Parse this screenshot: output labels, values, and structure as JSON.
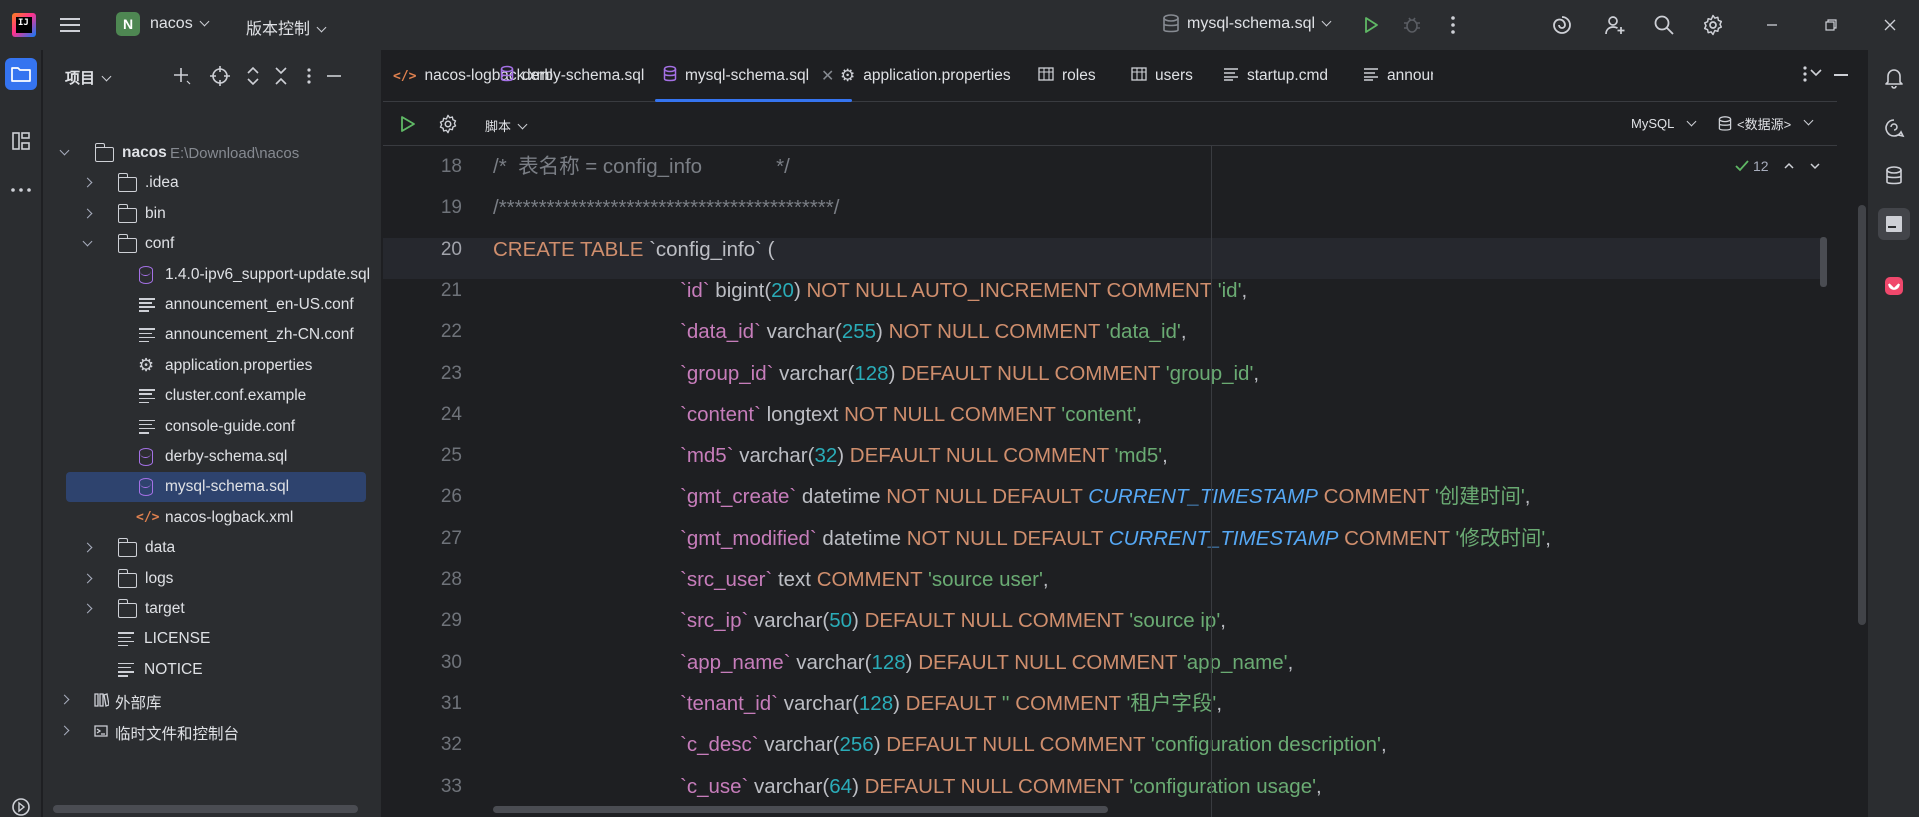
{
  "titlebar": {
    "project_initial": "N",
    "project_name": "nacos",
    "vcs_menu": "版本控制",
    "run_config": "mysql-schema.sql"
  },
  "project_panel": {
    "title": "项目",
    "tree": [
      {
        "label": "nacos",
        "path": "E:\\Download\\nacos",
        "type": "folder",
        "expanded": true
      },
      {
        "label": ".idea",
        "type": "folder"
      },
      {
        "label": "bin",
        "type": "folder"
      },
      {
        "label": "conf",
        "type": "folder",
        "expanded": true
      },
      {
        "label": "1.4.0-ipv6_support-update.sql",
        "type": "db"
      },
      {
        "label": "announcement_en-US.conf",
        "type": "text"
      },
      {
        "label": "announcement_zh-CN.conf",
        "type": "text"
      },
      {
        "label": "application.properties",
        "type": "gear"
      },
      {
        "label": "cluster.conf.example",
        "type": "text"
      },
      {
        "label": "console-guide.conf",
        "type": "text"
      },
      {
        "label": "derby-schema.sql",
        "type": "db"
      },
      {
        "label": "mysql-schema.sql",
        "type": "db",
        "selected": true
      },
      {
        "label": "nacos-logback.xml",
        "type": "xml"
      },
      {
        "label": "data",
        "type": "folder"
      },
      {
        "label": "logs",
        "type": "folder"
      },
      {
        "label": "target",
        "type": "folder"
      },
      {
        "label": "LICENSE",
        "type": "text"
      },
      {
        "label": "NOTICE",
        "type": "text"
      },
      {
        "label": "外部库",
        "type": "lib"
      },
      {
        "label": "临时文件和控制台",
        "type": "scratch"
      }
    ]
  },
  "tabs": [
    {
      "label": "nacos-logback.xml",
      "icon": "xml-icon"
    },
    {
      "label": "derby-schema.sql",
      "icon": "database-icon"
    },
    {
      "label": "mysql-schema.sql",
      "icon": "database-icon",
      "active": true
    },
    {
      "label": "application.properties",
      "icon": "gear-icon"
    },
    {
      "label": "roles",
      "icon": "table-icon"
    },
    {
      "label": "users",
      "icon": "table-icon"
    },
    {
      "label": "startup.cmd",
      "icon": "text-icon"
    },
    {
      "label": "announ",
      "icon": "text-icon"
    }
  ],
  "editor_toolbar": {
    "script_label": "脚本",
    "dialect": "MySQL",
    "datasource": "<数据源>",
    "inspection_count": "12"
  },
  "editor": {
    "current_line": 20,
    "lines": [
      {
        "n": "18",
        "indent": 0,
        "tokens": [
          {
            "t": "/*  表名称 = config_info             */",
            "c": "cmt"
          }
        ]
      },
      {
        "n": "19",
        "indent": 0,
        "tokens": [
          {
            "t": "/******************************************/",
            "c": "cmt"
          }
        ]
      },
      {
        "n": "20",
        "indent": 0,
        "tokens": [
          {
            "t": "CREATE TABLE ",
            "c": "kw"
          },
          {
            "t": "`config_info`",
            "c": "pl"
          },
          {
            "t": " (",
            "c": "pl"
          }
        ]
      },
      {
        "n": "21",
        "indent": 1,
        "tokens": [
          {
            "t": "`id`",
            "c": "id"
          },
          {
            "t": " bigint",
            "c": "pl"
          },
          {
            "t": "(",
            "c": "pl"
          },
          {
            "t": "20",
            "c": "num"
          },
          {
            "t": ") ",
            "c": "pl"
          },
          {
            "t": "NOT NULL AUTO_INCREMENT COMMENT ",
            "c": "kw"
          },
          {
            "t": "'id'",
            "c": "str"
          },
          {
            "t": ",",
            "c": "pl"
          }
        ]
      },
      {
        "n": "22",
        "indent": 1,
        "tokens": [
          {
            "t": "`data_id`",
            "c": "id"
          },
          {
            "t": " varchar",
            "c": "pl"
          },
          {
            "t": "(",
            "c": "pl"
          },
          {
            "t": "255",
            "c": "num"
          },
          {
            "t": ") ",
            "c": "pl"
          },
          {
            "t": "NOT NULL COMMENT ",
            "c": "kw"
          },
          {
            "t": "'data_id'",
            "c": "str"
          },
          {
            "t": ",",
            "c": "pl"
          }
        ]
      },
      {
        "n": "23",
        "indent": 1,
        "tokens": [
          {
            "t": "`group_id`",
            "c": "id"
          },
          {
            "t": " varchar",
            "c": "pl"
          },
          {
            "t": "(",
            "c": "pl"
          },
          {
            "t": "128",
            "c": "num"
          },
          {
            "t": ") ",
            "c": "pl"
          },
          {
            "t": "DEFAULT NULL COMMENT ",
            "c": "kw"
          },
          {
            "t": "'group_id'",
            "c": "str"
          },
          {
            "t": ",",
            "c": "pl"
          }
        ]
      },
      {
        "n": "24",
        "indent": 1,
        "tokens": [
          {
            "t": "`content`",
            "c": "id"
          },
          {
            "t": " longtext ",
            "c": "pl"
          },
          {
            "t": "NOT NULL COMMENT ",
            "c": "kw"
          },
          {
            "t": "'content'",
            "c": "str"
          },
          {
            "t": ",",
            "c": "pl"
          }
        ]
      },
      {
        "n": "25",
        "indent": 1,
        "tokens": [
          {
            "t": "`md5`",
            "c": "id"
          },
          {
            "t": " varchar",
            "c": "pl"
          },
          {
            "t": "(",
            "c": "pl"
          },
          {
            "t": "32",
            "c": "num"
          },
          {
            "t": ") ",
            "c": "pl"
          },
          {
            "t": "DEFAULT NULL COMMENT ",
            "c": "kw"
          },
          {
            "t": "'md5'",
            "c": "str"
          },
          {
            "t": ",",
            "c": "pl"
          }
        ]
      },
      {
        "n": "26",
        "indent": 1,
        "tokens": [
          {
            "t": "`gmt_create`",
            "c": "id"
          },
          {
            "t": " datetime ",
            "c": "pl"
          },
          {
            "t": "NOT NULL DEFAULT ",
            "c": "kw"
          },
          {
            "t": "CURRENT_TIMESTAMP",
            "c": "fn"
          },
          {
            "t": " COMMENT ",
            "c": "kw"
          },
          {
            "t": "'创建时间'",
            "c": "str"
          },
          {
            "t": ",",
            "c": "pl"
          }
        ]
      },
      {
        "n": "27",
        "indent": 1,
        "tokens": [
          {
            "t": "`gmt_modified`",
            "c": "id"
          },
          {
            "t": " datetime ",
            "c": "pl"
          },
          {
            "t": "NOT NULL DEFAULT ",
            "c": "kw"
          },
          {
            "t": "CURRENT_TIMESTAMP",
            "c": "fn"
          },
          {
            "t": " COMMENT ",
            "c": "kw"
          },
          {
            "t": "'修改时间'",
            "c": "str"
          },
          {
            "t": ",",
            "c": "pl"
          }
        ]
      },
      {
        "n": "28",
        "indent": 1,
        "tokens": [
          {
            "t": "`src_user`",
            "c": "id"
          },
          {
            "t": " text ",
            "c": "pl"
          },
          {
            "t": "COMMENT ",
            "c": "kw"
          },
          {
            "t": "'source user'",
            "c": "str"
          },
          {
            "t": ",",
            "c": "pl"
          }
        ]
      },
      {
        "n": "29",
        "indent": 1,
        "tokens": [
          {
            "t": "`src_ip`",
            "c": "id"
          },
          {
            "t": " varchar",
            "c": "pl"
          },
          {
            "t": "(",
            "c": "pl"
          },
          {
            "t": "50",
            "c": "num"
          },
          {
            "t": ") ",
            "c": "pl"
          },
          {
            "t": "DEFAULT NULL COMMENT ",
            "c": "kw"
          },
          {
            "t": "'source ip'",
            "c": "str"
          },
          {
            "t": ",",
            "c": "pl"
          }
        ]
      },
      {
        "n": "30",
        "indent": 1,
        "tokens": [
          {
            "t": "`app_name`",
            "c": "id"
          },
          {
            "t": " varchar",
            "c": "pl"
          },
          {
            "t": "(",
            "c": "pl"
          },
          {
            "t": "128",
            "c": "num"
          },
          {
            "t": ") ",
            "c": "pl"
          },
          {
            "t": "DEFAULT NULL COMMENT ",
            "c": "kw"
          },
          {
            "t": "'app_name'",
            "c": "str"
          },
          {
            "t": ",",
            "c": "pl"
          }
        ]
      },
      {
        "n": "31",
        "indent": 1,
        "tokens": [
          {
            "t": "`tenant_id`",
            "c": "id"
          },
          {
            "t": " varchar",
            "c": "pl"
          },
          {
            "t": "(",
            "c": "pl"
          },
          {
            "t": "128",
            "c": "num"
          },
          {
            "t": ") ",
            "c": "pl"
          },
          {
            "t": "DEFAULT ",
            "c": "kw"
          },
          {
            "t": "''",
            "c": "str"
          },
          {
            "t": " COMMENT ",
            "c": "kw"
          },
          {
            "t": "'租户字段'",
            "c": "str"
          },
          {
            "t": ",",
            "c": "pl"
          }
        ]
      },
      {
        "n": "32",
        "indent": 1,
        "tokens": [
          {
            "t": "`c_desc`",
            "c": "id"
          },
          {
            "t": " varchar",
            "c": "pl"
          },
          {
            "t": "(",
            "c": "pl"
          },
          {
            "t": "256",
            "c": "num"
          },
          {
            "t": ") ",
            "c": "pl"
          },
          {
            "t": "DEFAULT NULL COMMENT ",
            "c": "kw"
          },
          {
            "t": "'configuration description'",
            "c": "str"
          },
          {
            "t": ",",
            "c": "pl"
          }
        ]
      },
      {
        "n": "33",
        "indent": 1,
        "tokens": [
          {
            "t": "`c_use`",
            "c": "id"
          },
          {
            "t": " varchar",
            "c": "pl"
          },
          {
            "t": "(",
            "c": "pl"
          },
          {
            "t": "64",
            "c": "num"
          },
          {
            "t": ") ",
            "c": "pl"
          },
          {
            "t": "DEFAULT NULL COMMENT ",
            "c": "kw"
          },
          {
            "t": "'configuration usage'",
            "c": "str"
          },
          {
            "t": ",",
            "c": "pl"
          }
        ]
      }
    ]
  }
}
